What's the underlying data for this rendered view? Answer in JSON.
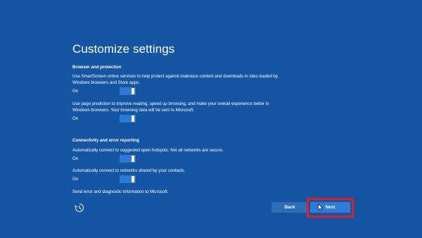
{
  "page": {
    "title": "Customize settings"
  },
  "sections": [
    {
      "heading": "Browser and protection",
      "items": [
        {
          "description": "Use SmartScreen online services to help protect against malicious content and downloads in sites loaded by Windows browsers and Store apps.",
          "state_label": "On"
        },
        {
          "description": "Use page prediction to improve reading, speed up browsing, and make your overall experience better in Windows browsers. Your browsing data will be sent to Microsoft.",
          "state_label": "On"
        }
      ]
    },
    {
      "heading": "Connectivity and error reporting",
      "items": [
        {
          "description": "Automatically connect to suggested open hotspots. Not all networks are secure.",
          "state_label": "On"
        },
        {
          "description": "Automatically connect to networks shared by your contacts.",
          "state_label": "On"
        },
        {
          "description": "Send error and diagnostic information to Microsoft."
        }
      ]
    }
  ],
  "footer": {
    "back_label": "Back",
    "next_label": "Next",
    "ease_of_access_icon": "ease-of-access-icon"
  },
  "colors": {
    "background": "#1556a4",
    "toggle_on": "#2c79d6",
    "highlight": "#e41c23"
  }
}
